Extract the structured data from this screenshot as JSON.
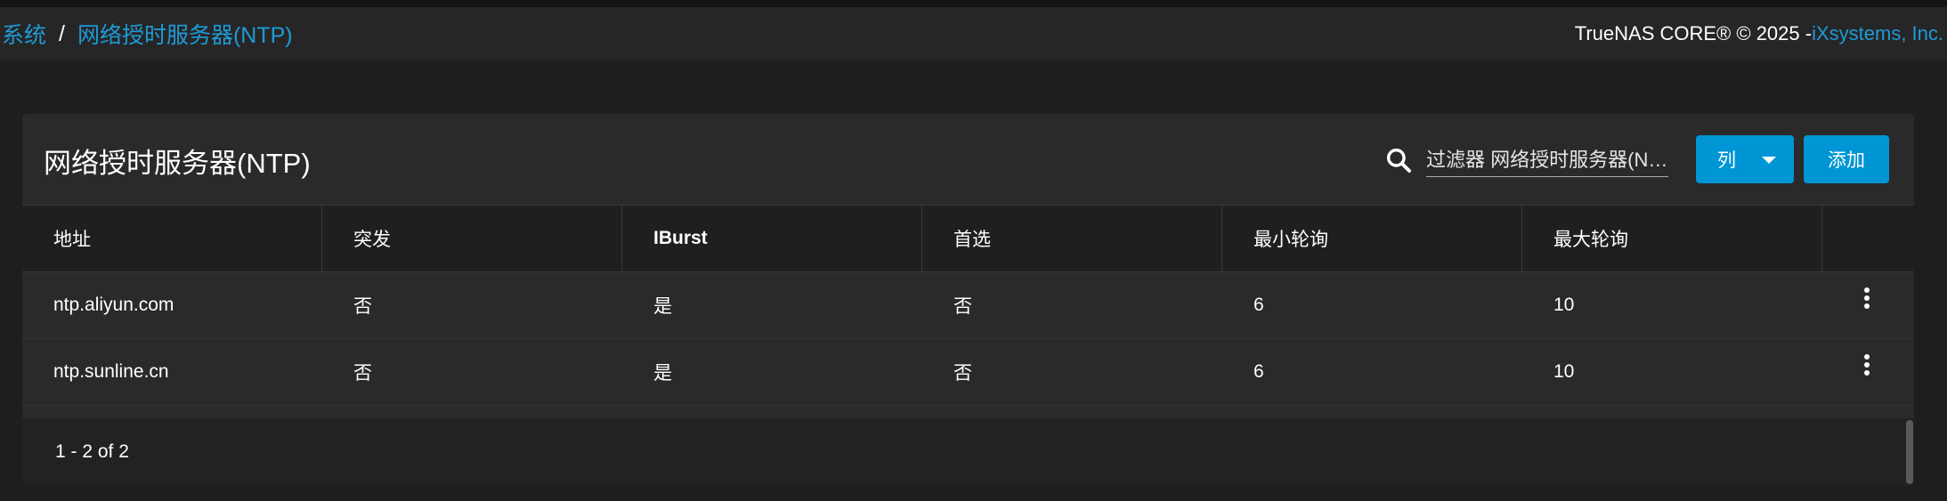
{
  "breadcrumb": {
    "root": "系统",
    "separator": "/",
    "current": "网络授时服务器(NTP)"
  },
  "copyright": {
    "prefix": "TrueNAS CORE® © 2025 - ",
    "company": "iXsystems, Inc."
  },
  "card": {
    "title": "网络授时服务器(NTP)"
  },
  "toolbar": {
    "filter_placeholder": "过滤器 网络授时服务器(NT...",
    "columns_label": "列",
    "add_label": "添加"
  },
  "table": {
    "headers": [
      "地址",
      "突发",
      "IBurst",
      "首选",
      "最小轮询",
      "最大轮询"
    ],
    "rows": [
      [
        "ntp.aliyun.com",
        "否",
        "是",
        "否",
        "6",
        "10"
      ],
      [
        "ntp.sunline.cn",
        "否",
        "是",
        "否",
        "6",
        "10"
      ]
    ]
  },
  "pager": {
    "summary": "1 - 2 of 2"
  },
  "icons": {
    "search": "search-icon",
    "columns_caret": "caret-down-icon",
    "row_menu": "more-vert-icon"
  },
  "colors": {
    "accent": "#0095d5",
    "link": "#1e9ad6",
    "background": "#1e1e1e",
    "card": "#2a2a2a"
  }
}
